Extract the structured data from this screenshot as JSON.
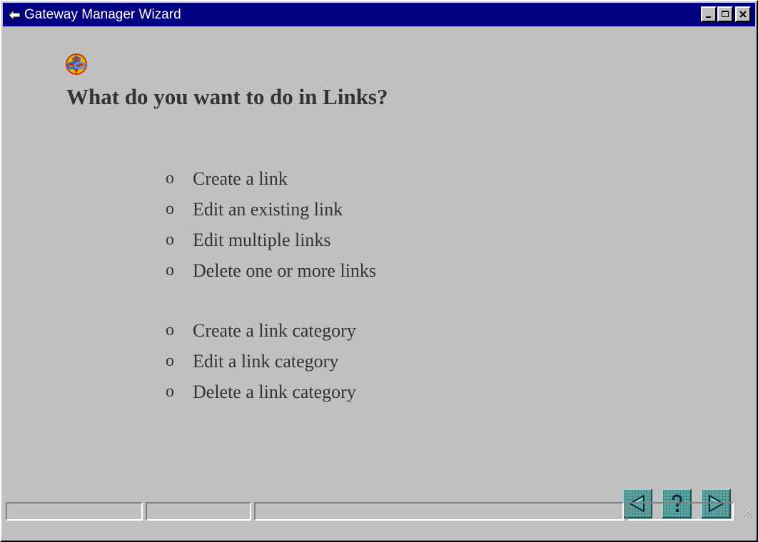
{
  "window": {
    "title": "Gateway Manager Wizard",
    "app_icon": "wizard-arrow-icon",
    "controls": {
      "minimize": "minimize-icon",
      "maximize": "maximize-icon",
      "close": "close-icon"
    }
  },
  "main": {
    "section_icon": "links-chain-icon",
    "heading": "What do you want to do in Links?",
    "bullet": "o",
    "link_options": [
      "Create a link",
      "Edit an existing link",
      "Edit multiple links",
      "Delete one or more links"
    ],
    "category_options": [
      "Create a link category",
      "Edit a link category",
      "Delete a link category"
    ]
  },
  "navigation": {
    "back": "back-arrow-icon",
    "help": "help-question-icon",
    "next": "next-arrow-icon",
    "accent_color": "#5aa9aa"
  },
  "statusbar": {
    "cells": [
      "",
      "",
      "",
      ""
    ]
  },
  "colors": {
    "titlebar": "#000080",
    "background": "#c0c0c0",
    "text": "#333333"
  }
}
